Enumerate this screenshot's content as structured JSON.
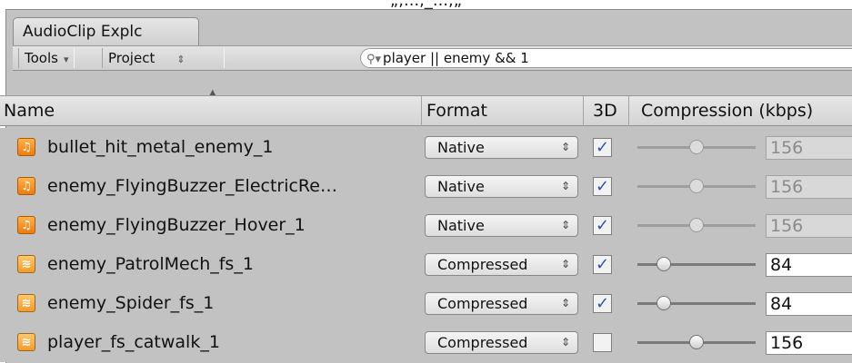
{
  "top_text": "„,...,_...,„",
  "tab": {
    "label": "AudioClip Explc"
  },
  "toolbar": {
    "tools_label": "Tools",
    "project_label": "Project",
    "search_value": "player || enemy && 1"
  },
  "columns": {
    "name": "Name",
    "format": "Format",
    "threed": "3D",
    "compression": "Compression (kbps)"
  },
  "rows": [
    {
      "name": "bullet_hit_metal_enemy_1",
      "format": "Native",
      "is3d": true,
      "compression": "156",
      "slider_pos": 0.5,
      "enabled": false,
      "icon": "audio-clip-icon"
    },
    {
      "name": "enemy_FlyingBuzzer_ElectricRe…",
      "format": "Native",
      "is3d": true,
      "compression": "156",
      "slider_pos": 0.5,
      "enabled": false,
      "icon": "audio-clip-icon"
    },
    {
      "name": "enemy_FlyingBuzzer_Hover_1",
      "format": "Native",
      "is3d": true,
      "compression": "156",
      "slider_pos": 0.5,
      "enabled": false,
      "icon": "audio-clip-icon"
    },
    {
      "name": "enemy_PatrolMech_fs_1",
      "format": "Compressed",
      "is3d": true,
      "compression": "84",
      "slider_pos": 0.22,
      "enabled": true,
      "icon": "compressed-audio-icon"
    },
    {
      "name": "enemy_Spider_fs_1",
      "format": "Compressed",
      "is3d": true,
      "compression": "84",
      "slider_pos": 0.22,
      "enabled": true,
      "icon": "compressed-audio-icon"
    },
    {
      "name": "player_fs_catwalk_1",
      "format": "Compressed",
      "is3d": false,
      "compression": "156",
      "slider_pos": 0.5,
      "enabled": true,
      "icon": "compressed-audio-icon"
    }
  ]
}
